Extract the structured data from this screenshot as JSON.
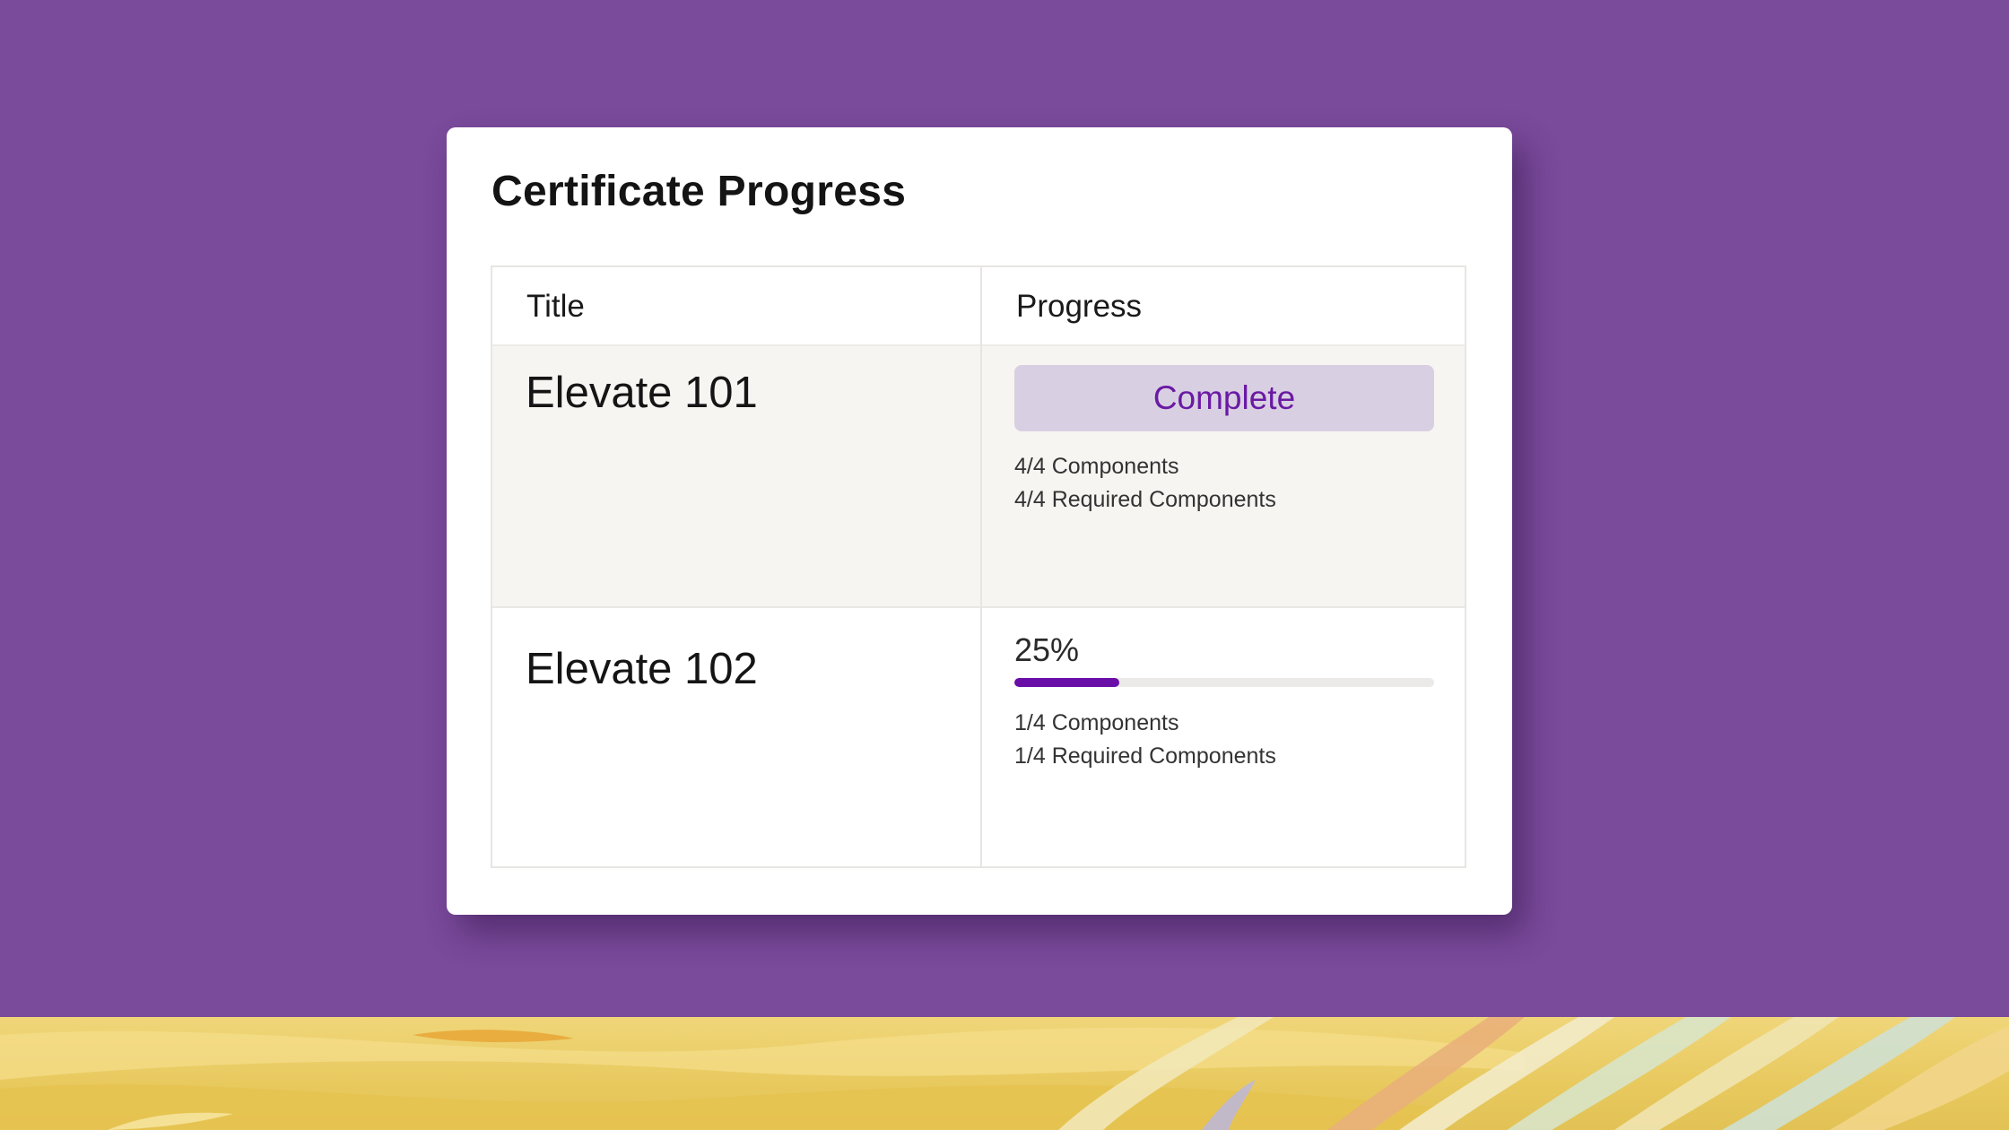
{
  "card": {
    "title": "Certificate Progress"
  },
  "table": {
    "headers": {
      "title": "Title",
      "progress": "Progress"
    },
    "rows": [
      {
        "title": "Elevate 101",
        "status": "Complete",
        "components": "4/4 Components",
        "required": "4/4 Required Components"
      },
      {
        "title": "Elevate 102",
        "percent_label": "25%",
        "progress_fraction": 0.25,
        "components": "1/4 Components",
        "required": "1/4 Required Components"
      }
    ]
  },
  "colors": {
    "background": "#7a4a9b",
    "accent": "#6a0ea8",
    "badge_bg": "#d9cfe2",
    "badge_text": "#6a1aa3"
  }
}
